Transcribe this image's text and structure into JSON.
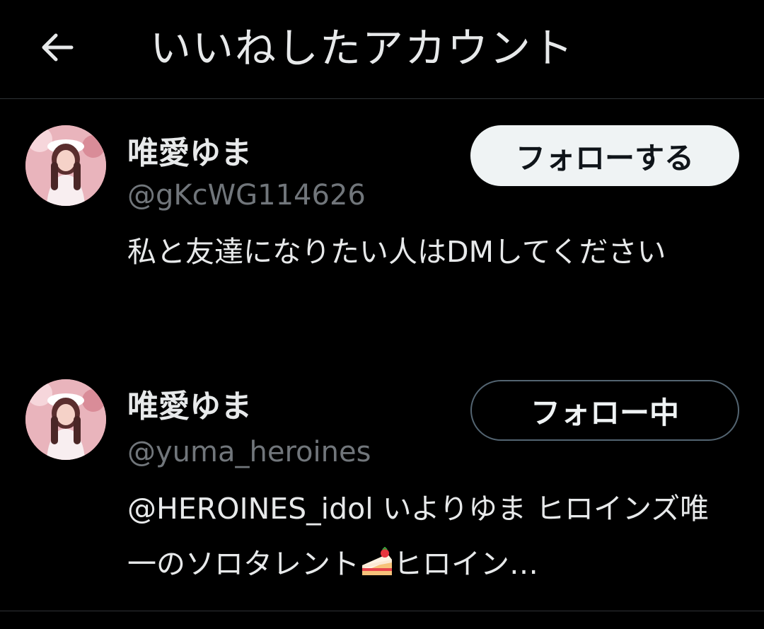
{
  "header": {
    "title": "いいねしたアカウント",
    "back_icon": "arrow-left-icon"
  },
  "users": [
    {
      "name": "唯愛ゆま",
      "handle": "@gKcWG114626",
      "bio": "私と友達になりたい人はDMしてください",
      "button_label": "フォローする",
      "following": false
    },
    {
      "name": "唯愛ゆま",
      "handle": "@yuma_heroines",
      "bio_before_emoji": "@HEROINES_idol いよりゆま ヒロインズ唯一のソロタレント",
      "bio_emoji": "cake-icon",
      "bio_after_emoji": "ヒロイン…",
      "button_label": "フォロー中",
      "following": true
    }
  ],
  "colors": {
    "background": "#000000",
    "text_primary": "#e7e9ea",
    "text_secondary": "#71767b",
    "divider": "#2f3336",
    "follow_button_bg": "#eff3f4",
    "following_button_border": "#536471"
  }
}
